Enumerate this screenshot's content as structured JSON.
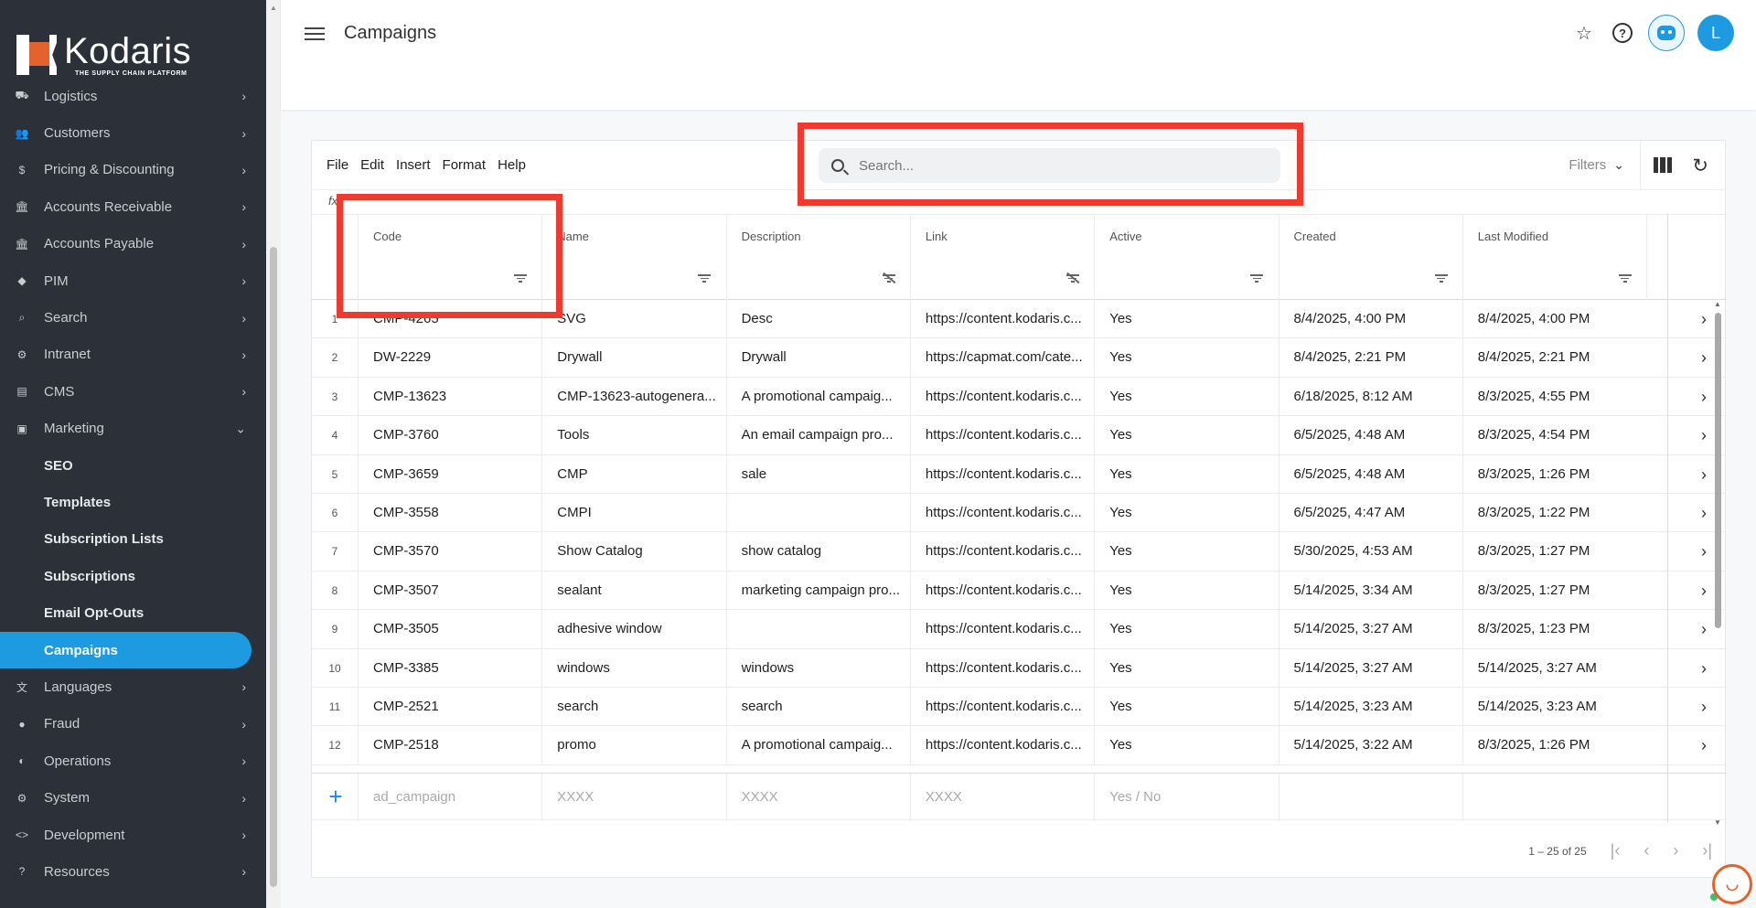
{
  "brand": {
    "name": "Kodaris",
    "tagline": "THE SUPPLY CHAIN PLATFORM"
  },
  "sidebar": {
    "items": [
      {
        "label": "Logistics",
        "icon": "truck-icon",
        "glyph": "⛟"
      },
      {
        "label": "Customers",
        "icon": "people-icon",
        "glyph": "👥"
      },
      {
        "label": "Pricing & Discounting",
        "icon": "dollar-icon",
        "glyph": "$"
      },
      {
        "label": "Accounts Receivable",
        "icon": "bank-icon",
        "glyph": "🏛"
      },
      {
        "label": "Accounts Payable",
        "icon": "bank-icon",
        "glyph": "🏛"
      },
      {
        "label": "PIM",
        "icon": "tag-icon",
        "glyph": "◆"
      },
      {
        "label": "Search",
        "icon": "search-icon",
        "glyph": "⌕"
      },
      {
        "label": "Intranet",
        "icon": "intranet-icon",
        "glyph": "⚙"
      },
      {
        "label": "CMS",
        "icon": "cms-icon",
        "glyph": "▤"
      },
      {
        "label": "Marketing",
        "icon": "marketing-icon",
        "glyph": "▣",
        "expanded": true
      }
    ],
    "marketing_sub": [
      "SEO",
      "Templates",
      "Subscription Lists",
      "Subscriptions",
      "Email Opt-Outs",
      "Campaigns"
    ],
    "active_sub": "Campaigns",
    "items_after": [
      {
        "label": "Languages",
        "icon": "translate-icon",
        "glyph": "文"
      },
      {
        "label": "Fraud",
        "icon": "alert-icon",
        "glyph": "●"
      },
      {
        "label": "Operations",
        "icon": "operations-icon",
        "glyph": "◐"
      },
      {
        "label": "System",
        "icon": "gear-icon",
        "glyph": "⚙"
      },
      {
        "label": "Development",
        "icon": "code-icon",
        "glyph": "<>"
      },
      {
        "label": "Resources",
        "icon": "help-icon",
        "glyph": "?"
      }
    ]
  },
  "header": {
    "title": "Campaigns",
    "avatar_initial": "L"
  },
  "toolbar": {
    "menus": [
      "File",
      "Edit",
      "Insert",
      "Format",
      "Help"
    ],
    "search_placeholder": "Search...",
    "filters_label": "Filters",
    "fx_label": "fx"
  },
  "table": {
    "columns": [
      "Code",
      "Name",
      "Description",
      "Link",
      "Active",
      "Created",
      "Last Modified"
    ],
    "rows": [
      [
        "1",
        "CMP-4265",
        "SVG",
        "Desc",
        "https://content.kodaris.c...",
        "Yes",
        "8/4/2025, 4:00 PM",
        "8/4/2025, 4:00 PM"
      ],
      [
        "2",
        "DW-2229",
        "Drywall",
        "Drywall",
        "https://capmat.com/cate...",
        "Yes",
        "8/4/2025, 2:21 PM",
        "8/4/2025, 2:21 PM"
      ],
      [
        "3",
        "CMP-13623",
        "CMP-13623-autogenera...",
        "A promotional campaig...",
        "https://content.kodaris.c...",
        "Yes",
        "6/18/2025, 8:12 AM",
        "8/3/2025, 4:55 PM"
      ],
      [
        "4",
        "CMP-3760",
        "Tools",
        "An email campaign pro...",
        "https://content.kodaris.c...",
        "Yes",
        "6/5/2025, 4:48 AM",
        "8/3/2025, 4:54 PM"
      ],
      [
        "5",
        "CMP-3659",
        "CMP",
        "sale",
        "https://content.kodaris.c...",
        "Yes",
        "6/5/2025, 4:48 AM",
        "8/3/2025, 1:26 PM"
      ],
      [
        "6",
        "CMP-3558",
        "CMPI",
        "",
        "https://content.kodaris.c...",
        "Yes",
        "6/5/2025, 4:47 AM",
        "8/3/2025, 1:22 PM"
      ],
      [
        "7",
        "CMP-3570",
        "Show Catalog",
        "show catalog",
        "https://content.kodaris.c...",
        "Yes",
        "5/30/2025, 4:53 AM",
        "8/3/2025, 1:27 PM"
      ],
      [
        "8",
        "CMP-3507",
        "sealant",
        "marketing campaign pro...",
        "https://content.kodaris.c...",
        "Yes",
        "5/14/2025, 3:34 AM",
        "8/3/2025, 1:27 PM"
      ],
      [
        "9",
        "CMP-3505",
        "adhesive window",
        "",
        "https://content.kodaris.c...",
        "Yes",
        "5/14/2025, 3:27 AM",
        "8/3/2025, 1:23 PM"
      ],
      [
        "10",
        "CMP-3385",
        "windows",
        "windows",
        "https://content.kodaris.c...",
        "Yes",
        "5/14/2025, 3:27 AM",
        "5/14/2025, 3:27 AM"
      ],
      [
        "11",
        "CMP-2521",
        "search",
        "search",
        "https://content.kodaris.c...",
        "Yes",
        "5/14/2025, 3:23 AM",
        "5/14/2025, 3:23 AM"
      ],
      [
        "12",
        "CMP-2518",
        "promo",
        "A promotional campaig...",
        "https://content.kodaris.c...",
        "Yes",
        "5/14/2025, 3:22 AM",
        "8/3/2025, 1:26 PM"
      ]
    ],
    "new_row": [
      "ad_campaign",
      "XXXX",
      "XXXX",
      "XXXX",
      "Yes / No"
    ],
    "filter_off_columns": [
      2,
      3
    ]
  },
  "pager": {
    "range": "1 – 25 of 25"
  },
  "colors": {
    "accent": "#1e9be0",
    "highlight": "#f03a2f",
    "sidebar_bg": "#2c3038"
  }
}
